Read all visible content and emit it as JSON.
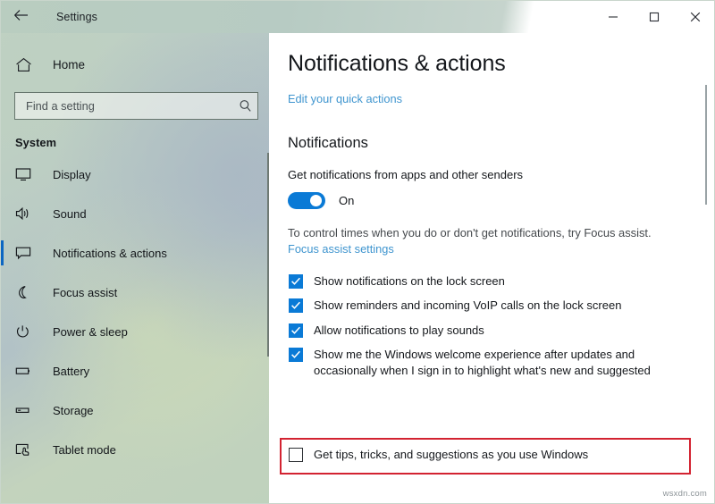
{
  "window": {
    "title": "Settings",
    "back_icon": "back-arrow-icon",
    "minimize_label": "Minimize",
    "maximize_label": "Maximize",
    "close_label": "Close"
  },
  "sidebar": {
    "home": {
      "label": "Home",
      "icon": "home-icon"
    },
    "search": {
      "placeholder": "Find a setting",
      "value": "",
      "icon": "search-icon"
    },
    "section_title": "System",
    "items": [
      {
        "label": "Display",
        "icon": "monitor-icon",
        "selected": false
      },
      {
        "label": "Sound",
        "icon": "speaker-icon",
        "selected": false
      },
      {
        "label": "Notifications & actions",
        "icon": "notification-icon",
        "selected": true
      },
      {
        "label": "Focus assist",
        "icon": "moon-icon",
        "selected": false
      },
      {
        "label": "Power & sleep",
        "icon": "power-icon",
        "selected": false
      },
      {
        "label": "Battery",
        "icon": "battery-icon",
        "selected": false
      },
      {
        "label": "Storage",
        "icon": "storage-icon",
        "selected": false
      },
      {
        "label": "Tablet mode",
        "icon": "tablet-icon",
        "selected": false
      }
    ]
  },
  "main": {
    "page_title": "Notifications & actions",
    "quick_actions_link": "Edit your quick actions",
    "group_heading": "Notifications",
    "toggle": {
      "label": "Get notifications from apps and other senders",
      "state_text": "On",
      "on": true
    },
    "description": "To control times when you do or don't get notifications, try Focus assist.",
    "focus_link": "Focus assist settings",
    "checkboxes": [
      {
        "label": "Show notifications on the lock screen",
        "checked": true
      },
      {
        "label": "Show reminders and incoming VoIP calls on the lock screen",
        "checked": true
      },
      {
        "label": "Allow notifications to play sounds",
        "checked": true
      },
      {
        "label": "Show me the Windows welcome experience after updates and occasionally when I sign in to highlight what's new and suggested",
        "checked": true
      }
    ],
    "highlighted_checkbox": {
      "label": "Get tips, tricks, and suggestions as you use Windows",
      "checked": false
    }
  },
  "colors": {
    "accent_blue": "#0a7ad6",
    "selection_bar": "#0c66c2",
    "link_blue": "#3f95cf",
    "highlight_red": "#d32331"
  },
  "watermark": "wsxdn.com"
}
